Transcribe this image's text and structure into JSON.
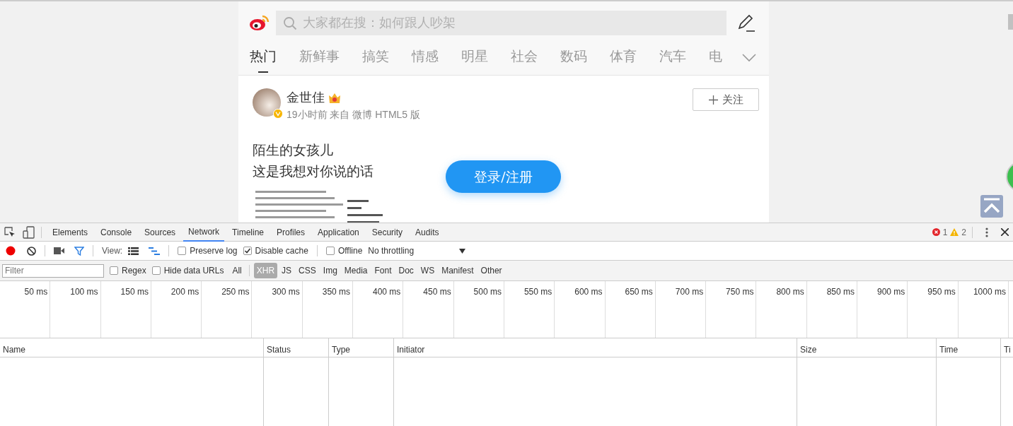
{
  "weibo": {
    "search_placeholder": "大家都在搜：如何跟人吵架",
    "channels": [
      {
        "label": "热门",
        "selected": true
      },
      {
        "label": "新鲜事",
        "selected": false
      },
      {
        "label": "搞笑",
        "selected": false
      },
      {
        "label": "情感",
        "selected": false
      },
      {
        "label": "明星",
        "selected": false
      },
      {
        "label": "社会",
        "selected": false
      },
      {
        "label": "数码",
        "selected": false
      },
      {
        "label": "体育",
        "selected": false
      },
      {
        "label": "汽车",
        "selected": false
      },
      {
        "label": "电",
        "selected": false
      }
    ],
    "post": {
      "author": "金世佳",
      "meta": "19小时前 来自 微博 HTML5 版",
      "follow_label": "关注",
      "lines": [
        "陌生的女孩儿",
        "这是我想对你说的话"
      ]
    },
    "login_label": "登录/注册"
  },
  "devtools": {
    "panels": [
      {
        "label": "Elements",
        "selected": false
      },
      {
        "label": "Console",
        "selected": false
      },
      {
        "label": "Sources",
        "selected": false
      },
      {
        "label": "Network",
        "selected": true
      },
      {
        "label": "Timeline",
        "selected": false
      },
      {
        "label": "Profiles",
        "selected": false
      },
      {
        "label": "Application",
        "selected": false
      },
      {
        "label": "Security",
        "selected": false
      },
      {
        "label": "Audits",
        "selected": false
      }
    ],
    "errors": "1",
    "warnings": "2",
    "toolbar": {
      "recording": true,
      "view_label": "View:",
      "options": [
        {
          "label": "Preserve log",
          "checked": false
        },
        {
          "label": "Disable cache",
          "checked": true
        }
      ],
      "offline": {
        "label": "Offline",
        "checked": false
      },
      "throttling": "No throttling"
    },
    "filter": {
      "placeholder": "Filter",
      "options": [
        {
          "label": "Regex",
          "checked": false
        },
        {
          "label": "Hide data URLs",
          "checked": false
        }
      ],
      "types": [
        {
          "label": "All",
          "selected": false
        },
        {
          "label": "XHR",
          "selected": true
        },
        {
          "label": "JS",
          "selected": false
        },
        {
          "label": "CSS",
          "selected": false
        },
        {
          "label": "Img",
          "selected": false
        },
        {
          "label": "Media",
          "selected": false
        },
        {
          "label": "Font",
          "selected": false
        },
        {
          "label": "Doc",
          "selected": false
        },
        {
          "label": "WS",
          "selected": false
        },
        {
          "label": "Manifest",
          "selected": false
        },
        {
          "label": "Other",
          "selected": false
        }
      ]
    },
    "timeline_ticks": [
      "50 ms",
      "100 ms",
      "150 ms",
      "200 ms",
      "250 ms",
      "300 ms",
      "350 ms",
      "400 ms",
      "450 ms",
      "500 ms",
      "550 ms",
      "600 ms",
      "650 ms",
      "700 ms",
      "750 ms",
      "800 ms",
      "850 ms",
      "900 ms",
      "950 ms",
      "1000 ms"
    ],
    "columns": [
      "Name",
      "Status",
      "Type",
      "Initiator",
      "Size",
      "Time",
      "Ti"
    ]
  }
}
